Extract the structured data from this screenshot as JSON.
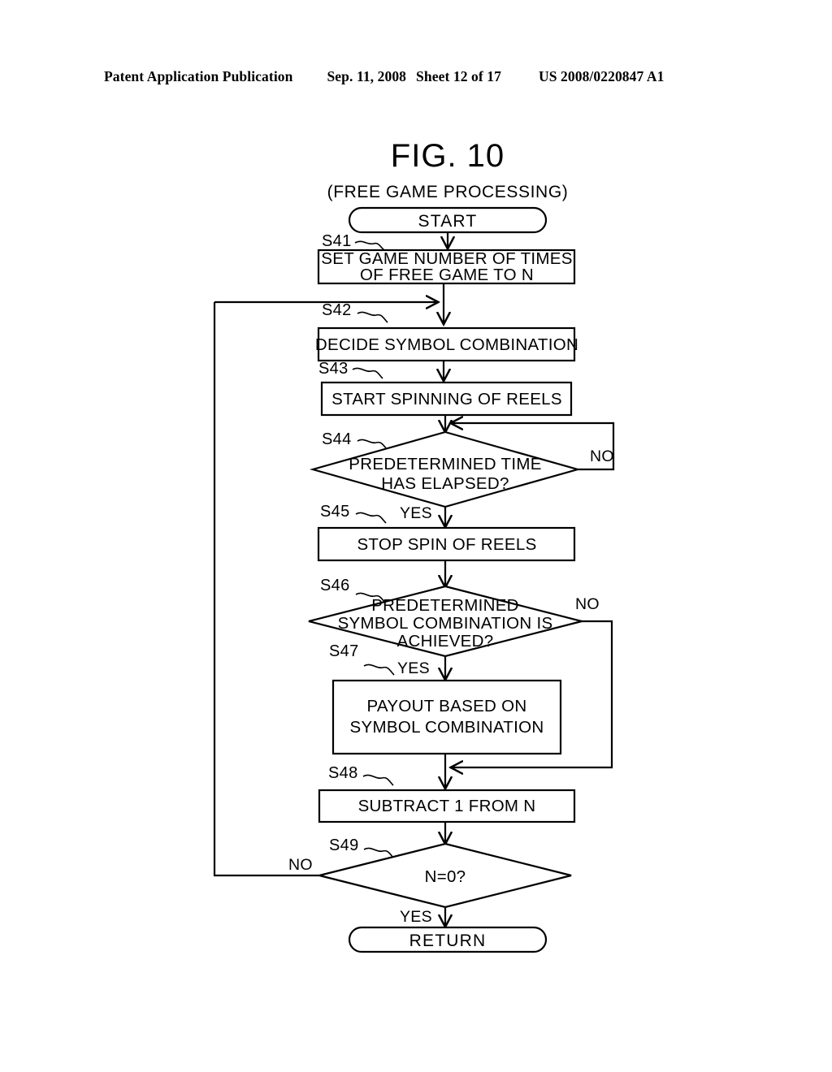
{
  "header": {
    "publication": "Patent Application Publication",
    "date": "Sep. 11, 2008",
    "sheet": "Sheet 12 of 17",
    "patent_number": "US 2008/0220847 A1"
  },
  "figure": {
    "title": "FIG. 10",
    "subtitle": "(FREE GAME PROCESSING)"
  },
  "chart_data": {
    "type": "flowchart",
    "title": "FIG. 10",
    "subtitle": "(FREE GAME PROCESSING)",
    "nodes": [
      {
        "id": "start",
        "shape": "terminator",
        "label": "START"
      },
      {
        "id": "S41",
        "step": "S41",
        "shape": "process",
        "line1": "SET GAME NUMBER OF TIMES",
        "line2": "OF FREE GAME TO N"
      },
      {
        "id": "S42",
        "step": "S42",
        "shape": "process",
        "line1": "DECIDE SYMBOL COMBINATION"
      },
      {
        "id": "S43",
        "step": "S43",
        "shape": "process",
        "line1": "START SPINNING OF REELS"
      },
      {
        "id": "S44",
        "step": "S44",
        "shape": "decision",
        "line1": "PREDETERMINED TIME",
        "line2": "HAS ELAPSED?",
        "yes": "YES",
        "no": "NO"
      },
      {
        "id": "S45",
        "step": "S45",
        "shape": "process",
        "line1": "STOP SPIN OF REELS"
      },
      {
        "id": "S46",
        "step": "S46",
        "shape": "decision",
        "line1": "PREDETERMINED",
        "line2": "SYMBOL COMBINATION IS",
        "line3": "ACHIEVED?",
        "yes": "YES",
        "no": "NO"
      },
      {
        "id": "S47",
        "step": "S47",
        "shape": "process",
        "line1": "PAYOUT BASED ON",
        "line2": "SYMBOL COMBINATION"
      },
      {
        "id": "S48",
        "step": "S48",
        "shape": "process",
        "line1": "SUBTRACT 1 FROM N"
      },
      {
        "id": "S49",
        "step": "S49",
        "shape": "decision",
        "line1": "N=0?",
        "yes": "YES",
        "no": "NO"
      },
      {
        "id": "return",
        "shape": "terminator",
        "label": "RETURN"
      }
    ],
    "edges": [
      {
        "from": "start",
        "to": "S41"
      },
      {
        "from": "S41",
        "to": "S42"
      },
      {
        "from": "S42",
        "to": "S43"
      },
      {
        "from": "S43",
        "to": "S44"
      },
      {
        "from": "S44",
        "to": "S45",
        "label": "YES"
      },
      {
        "from": "S44",
        "to": "S44",
        "label": "NO"
      },
      {
        "from": "S45",
        "to": "S46"
      },
      {
        "from": "S46",
        "to": "S47",
        "label": "YES"
      },
      {
        "from": "S46",
        "to": "S48",
        "label": "NO"
      },
      {
        "from": "S47",
        "to": "S48"
      },
      {
        "from": "S48",
        "to": "S49"
      },
      {
        "from": "S49",
        "to": "return",
        "label": "YES"
      },
      {
        "from": "S49",
        "to": "S42",
        "label": "NO"
      }
    ]
  },
  "labels": {
    "start": "START",
    "return": "RETURN",
    "s41": "S41",
    "s41_l1": "SET GAME NUMBER OF TIMES",
    "s41_l2": "OF FREE GAME TO N",
    "s42": "S42",
    "s42_l1": "DECIDE SYMBOL COMBINATION",
    "s43": "S43",
    "s43_l1": "START SPINNING OF REELS",
    "s44": "S44",
    "s44_l1": "PREDETERMINED TIME",
    "s44_l2": "HAS ELAPSED?",
    "s44_no": "NO",
    "s44_yes": "YES",
    "s45": "S45",
    "s45_l1": "STOP SPIN OF REELS",
    "s46": "S46",
    "s46_l1": "PREDETERMINED",
    "s46_l2": "SYMBOL COMBINATION IS",
    "s46_l3": "ACHIEVED?",
    "s46_no": "NO",
    "s46_yes": "YES",
    "s47": "S47",
    "s47_l1": "PAYOUT BASED ON",
    "s47_l2": "SYMBOL COMBINATION",
    "s48": "S48",
    "s48_l1": "SUBTRACT 1 FROM N",
    "s49": "S49",
    "s49_l1": "N=0?",
    "s49_no": "NO",
    "s49_yes": "YES"
  }
}
